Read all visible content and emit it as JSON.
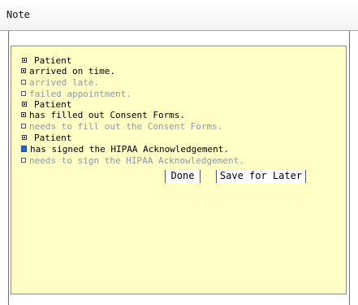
{
  "window": {
    "title": "Note"
  },
  "note": {
    "items": [
      {
        "kind": "header",
        "label": "Patient",
        "checked": true
      },
      {
        "kind": "option",
        "label": "arrived on time.",
        "checked": true,
        "state": "on"
      },
      {
        "kind": "option",
        "label": "arrived late.",
        "checked": false,
        "state": "off"
      },
      {
        "kind": "option",
        "label": "failed appointment.",
        "checked": false,
        "state": "off"
      },
      {
        "kind": "header",
        "label": "Patient",
        "checked": true
      },
      {
        "kind": "option",
        "label": "has filled out Consent Forms.",
        "checked": true,
        "state": "on"
      },
      {
        "kind": "option",
        "label": "needs to fill out the Consent Forms.",
        "checked": false,
        "state": "off"
      },
      {
        "kind": "header",
        "label": "Patient",
        "checked": true
      },
      {
        "kind": "option",
        "label": "has signed the HIPAA Acknowledgement.",
        "checked": true,
        "state": "on",
        "focused": true
      },
      {
        "kind": "option",
        "label": "needs to sign the HIPAA Acknowledgement.",
        "checked": false,
        "state": "off"
      }
    ],
    "buttons": {
      "done": "Done",
      "save_for_later": "Save for Later"
    }
  },
  "colors": {
    "note_background": "#ffffc6",
    "enabled_text": "#000000",
    "disabled_text": "#8a9aa6",
    "focus_checkbox": "#2a62c4"
  }
}
